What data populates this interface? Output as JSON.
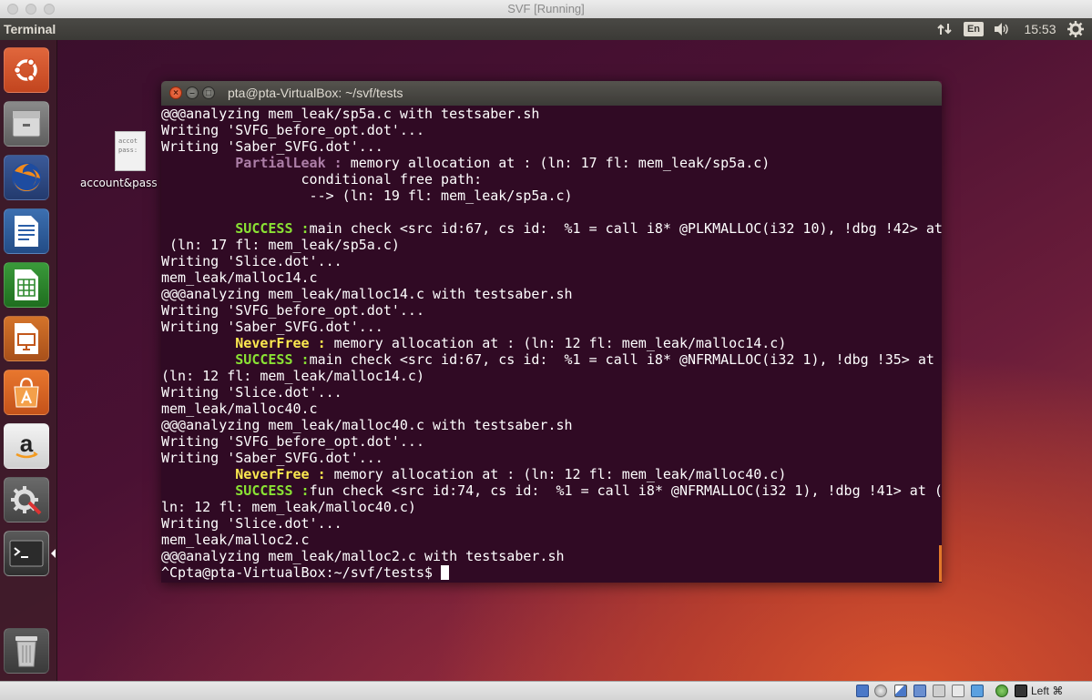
{
  "host_window": {
    "title": "SVF [Running]"
  },
  "top_panel": {
    "app_name": "Terminal",
    "keyboard_layout": "En",
    "clock": "15:53",
    "network_icon": "network-updown-icon",
    "volume_icon": "speaker-icon",
    "settings_icon": "gear-icon"
  },
  "launcher": {
    "items": [
      {
        "name": "ubuntu-dash-icon"
      },
      {
        "name": "files-icon"
      },
      {
        "name": "firefox-icon"
      },
      {
        "name": "libreoffice-writer-icon"
      },
      {
        "name": "libreoffice-calc-icon"
      },
      {
        "name": "libreoffice-impress-icon"
      },
      {
        "name": "software-center-icon"
      },
      {
        "name": "amazon-icon"
      },
      {
        "name": "system-settings-icon"
      },
      {
        "name": "terminal-icon"
      },
      {
        "name": "trash-icon"
      }
    ]
  },
  "desktop": {
    "file_label": "account&pass",
    "file_preview": [
      "accot",
      "pass:"
    ]
  },
  "terminal": {
    "title": "pta@pta-VirtualBox: ~/svf/tests",
    "lines": [
      [
        {
          "t": "@@@analyzing mem_leak/sp5a.c with testsaber.sh"
        }
      ],
      [
        {
          "t": "Writing 'SVFG_before_opt.dot'..."
        }
      ],
      [
        {
          "t": "Writing 'Saber_SVFG.dot'..."
        }
      ],
      [
        {
          "t": "         "
        },
        {
          "t": "PartialLeak :",
          "c": "lbl-purple"
        },
        {
          "t": " memory allocation at : (ln: 17 fl: mem_leak/sp5a.c)"
        }
      ],
      [
        {
          "t": "                 conditional free path:"
        }
      ],
      [
        {
          "t": "                  --> (ln: 19 fl: mem_leak/sp5a.c)"
        }
      ],
      [
        {
          "t": ""
        }
      ],
      [
        {
          "t": "         "
        },
        {
          "t": "SUCCESS :",
          "c": "lbl-green"
        },
        {
          "t": "main check <src id:67, cs id:  %1 = call i8* @PLKMALLOC(i32 10), !dbg !42> at"
        }
      ],
      [
        {
          "t": " (ln: 17 fl: mem_leak/sp5a.c)"
        }
      ],
      [
        {
          "t": "Writing 'Slice.dot'..."
        }
      ],
      [
        {
          "t": "mem_leak/malloc14.c"
        }
      ],
      [
        {
          "t": "@@@analyzing mem_leak/malloc14.c with testsaber.sh"
        }
      ],
      [
        {
          "t": "Writing 'SVFG_before_opt.dot'..."
        }
      ],
      [
        {
          "t": "Writing 'Saber_SVFG.dot'..."
        }
      ],
      [
        {
          "t": "         "
        },
        {
          "t": "NeverFree :",
          "c": "lbl-yellow"
        },
        {
          "t": " memory allocation at : (ln: 12 fl: mem_leak/malloc14.c)"
        }
      ],
      [
        {
          "t": "         "
        },
        {
          "t": "SUCCESS :",
          "c": "lbl-green"
        },
        {
          "t": "main check <src id:67, cs id:  %1 = call i8* @NFRMALLOC(i32 1), !dbg !35> at"
        }
      ],
      [
        {
          "t": "(ln: 12 fl: mem_leak/malloc14.c)"
        }
      ],
      [
        {
          "t": "Writing 'Slice.dot'..."
        }
      ],
      [
        {
          "t": "mem_leak/malloc40.c"
        }
      ],
      [
        {
          "t": "@@@analyzing mem_leak/malloc40.c with testsaber.sh"
        }
      ],
      [
        {
          "t": "Writing 'SVFG_before_opt.dot'..."
        }
      ],
      [
        {
          "t": "Writing 'Saber_SVFG.dot'..."
        }
      ],
      [
        {
          "t": "         "
        },
        {
          "t": "NeverFree :",
          "c": "lbl-yellow"
        },
        {
          "t": " memory allocation at : (ln: 12 fl: mem_leak/malloc40.c)"
        }
      ],
      [
        {
          "t": "         "
        },
        {
          "t": "SUCCESS :",
          "c": "lbl-green"
        },
        {
          "t": "fun check <src id:74, cs id:  %1 = call i8* @NFRMALLOC(i32 1), !dbg !41> at ("
        }
      ],
      [
        {
          "t": "ln: 12 fl: mem_leak/malloc40.c)"
        }
      ],
      [
        {
          "t": "Writing 'Slice.dot'..."
        }
      ],
      [
        {
          "t": "mem_leak/malloc2.c"
        }
      ],
      [
        {
          "t": "@@@analyzing mem_leak/malloc2.c with testsaber.sh"
        }
      ]
    ],
    "prompt": "^Cpta@pta-VirtualBox:~/svf/tests$ "
  },
  "status_bar": {
    "host_key": "Left ⌘"
  },
  "colors": {
    "terminal_bg": "#300a24",
    "partial_leak": "#ad7fa8",
    "never_free": "#fce94f",
    "success": "#8ae234"
  }
}
